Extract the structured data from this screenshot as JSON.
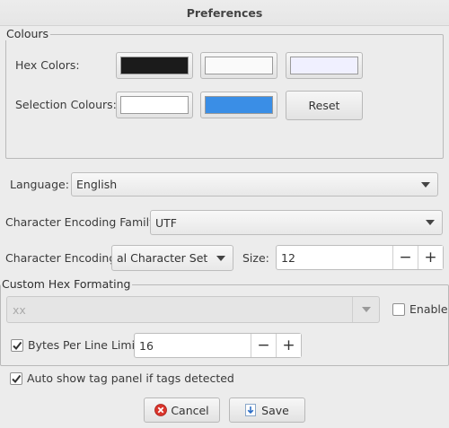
{
  "window": {
    "title": "Preferences"
  },
  "colours": {
    "group_title": "Colours",
    "hex_label": "Hex Colors:",
    "hex_swatches": [
      {
        "color": "#1b1b1b"
      },
      {
        "color": "#fafafa"
      },
      {
        "color": "#f0f0ff"
      }
    ],
    "selection_label": "Selection Colours:",
    "selection_swatches": [
      {
        "color": "#ffffff"
      },
      {
        "color": "#3a8ee6"
      }
    ],
    "reset_label": "Reset"
  },
  "language": {
    "label": "Language:",
    "value": "English"
  },
  "encoding_family": {
    "label": "Character Encoding Family:",
    "value": "UTF"
  },
  "encoding": {
    "label": "Character Encoding:",
    "value": "al Character Set",
    "size_label": "Size:",
    "size_value": "12",
    "minus": "−",
    "plus": "+"
  },
  "custom_hex": {
    "group_title": "Custom Hex Formating",
    "format_value": "xx",
    "enable_label": "Enable",
    "enable_checked": false,
    "bytes_label": "Bytes Per Line Limit",
    "bytes_checked": true,
    "bytes_value": "16",
    "minus": "−",
    "plus": "+"
  },
  "auto_show": {
    "label": "Auto show tag panel if tags detected",
    "checked": true
  },
  "footer": {
    "cancel_label": "Cancel",
    "save_label": "Save"
  }
}
